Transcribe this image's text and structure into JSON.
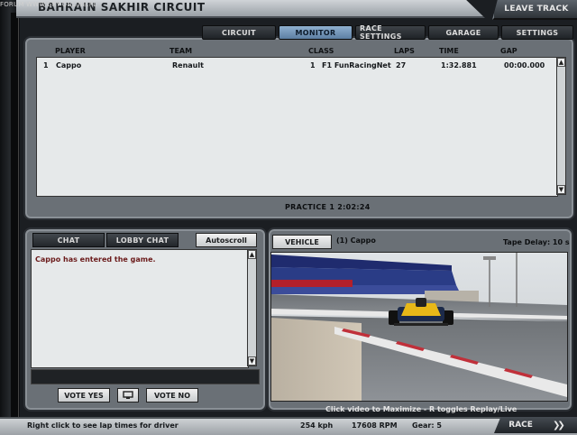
{
  "watermark": "FORUM WWW.GRY-ONLINE.PL",
  "header": {
    "title": "BAHRAIN SAKHIR CIRCUIT",
    "leave_track": "LEAVE TRACK"
  },
  "tabs": [
    {
      "label": "CIRCUIT",
      "active": false
    },
    {
      "label": "MONITOR",
      "active": true
    },
    {
      "label": "RACE SETTINGS",
      "active": false
    },
    {
      "label": "GARAGE",
      "active": false
    },
    {
      "label": "SETTINGS",
      "active": false
    }
  ],
  "table": {
    "headers": {
      "player": "PLAYER",
      "team": "TEAM",
      "class": "CLASS",
      "laps": "LAPS",
      "time": "TIME",
      "gap": "GAP"
    },
    "rows": [
      {
        "pos": "1",
        "player": "Cappo",
        "team": "Renault",
        "class_num": "1",
        "class": "F1 FunRacingNet",
        "laps": "27",
        "time": "1:32.881",
        "gap": "00:00.000"
      }
    ]
  },
  "session": "PRACTICE 1   2:02:24",
  "chat": {
    "chat_tab": "CHAT",
    "lobby_tab": "LOBBY CHAT",
    "autoscroll": "Autoscroll",
    "message": "Cappo has entered the game.",
    "vote_yes": "VOTE YES",
    "vote_no": "VOTE NO"
  },
  "vehicle": {
    "button": "VEHICLE",
    "driver": "(1) Cappo",
    "tape_delay": "Tape Delay: 10 s",
    "hint": "Click video to Maximize  -  R toggles Replay/Live"
  },
  "status": {
    "hint": "Right click to see lap times for driver",
    "speed": "254 kph",
    "rpm": "17608 RPM",
    "gear": "Gear: 5",
    "race": "RACE"
  }
}
